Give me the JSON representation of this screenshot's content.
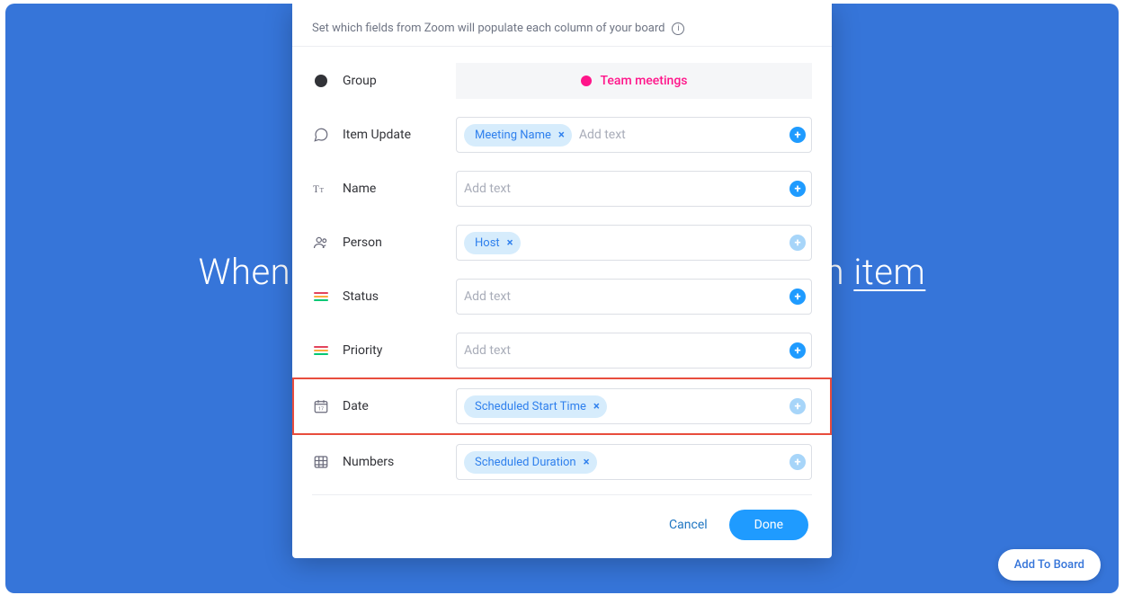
{
  "background": {
    "sentence_prefix": "When s",
    "sentence_mid": "an ",
    "sentence_word": "item"
  },
  "modal": {
    "header": "Set which fields from Zoom will populate each column of your board",
    "placeholder": "Add text",
    "rows": {
      "group": {
        "label": "Group",
        "banner": "Team meetings"
      },
      "item_update": {
        "label": "Item Update",
        "token": "Meeting Name"
      },
      "name": {
        "label": "Name"
      },
      "person": {
        "label": "Person",
        "token": "Host"
      },
      "status": {
        "label": "Status"
      },
      "priority": {
        "label": "Priority"
      },
      "date": {
        "label": "Date",
        "token": "Scheduled Start Time"
      },
      "numbers": {
        "label": "Numbers",
        "token": "Scheduled Duration"
      }
    },
    "footer": {
      "cancel": "Cancel",
      "done": "Done"
    }
  },
  "add_to_board": "Add To Board"
}
